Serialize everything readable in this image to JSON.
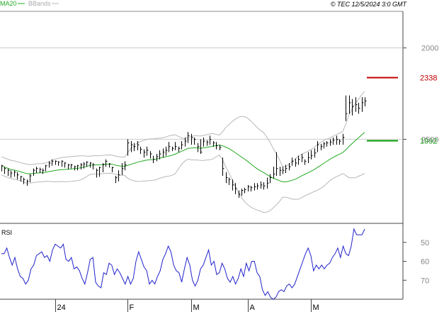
{
  "header": {
    "legend_ma": "MA20",
    "legend_bb": "BBands",
    "copyright": "© TEC 12/5/2024 3:0 GMT"
  },
  "price_axis": {
    "ticks": [
      "2500",
      "2000"
    ]
  },
  "rsi_axis": {
    "label": "RSI",
    "ticks": [
      "70",
      "60",
      "50"
    ]
  },
  "x_axis": {
    "ticks": [
      "24",
      "F",
      "M",
      "A",
      "M"
    ]
  },
  "levels": [
    {
      "value": 2338,
      "label": "2338",
      "color": "#c00000"
    },
    {
      "value": 1992,
      "label": "1992",
      "color": "#009900"
    }
  ],
  "colors": {
    "bars": "#000000",
    "ma": "#22aa22",
    "bbands": "#b8b8b8",
    "rsi": "#2222cc",
    "grid": "#cccccc",
    "axis": "#444444",
    "text": "#000000"
  },
  "chart_data": [
    {
      "type": "ohlc",
      "panel": "price",
      "ylim": [
        1540,
        2700
      ],
      "ticks": [
        2000,
        2500
      ],
      "grid": true,
      "bars": [
        [
          1855,
          1825,
          1860
        ],
        [
          1840,
          1810,
          1850
        ],
        [
          1830,
          1800,
          1840
        ],
        [
          1815,
          1790,
          1830
        ],
        [
          1820,
          1795,
          1830
        ],
        [
          1805,
          1780,
          1820
        ],
        [
          1795,
          1770,
          1800
        ],
        [
          1780,
          1755,
          1790
        ],
        [
          1770,
          1745,
          1780
        ],
        [
          1800,
          1765,
          1810
        ],
        [
          1830,
          1800,
          1840
        ],
        [
          1840,
          1815,
          1850
        ],
        [
          1835,
          1815,
          1845
        ],
        [
          1830,
          1810,
          1840
        ],
        [
          1855,
          1825,
          1860
        ],
        [
          1870,
          1845,
          1880
        ],
        [
          1880,
          1855,
          1890
        ],
        [
          1880,
          1860,
          1885
        ],
        [
          1875,
          1855,
          1880
        ],
        [
          1880,
          1850,
          1885
        ],
        [
          1870,
          1845,
          1875
        ],
        [
          1860,
          1835,
          1865
        ],
        [
          1860,
          1840,
          1865
        ],
        [
          1850,
          1830,
          1855
        ],
        [
          1855,
          1830,
          1860
        ],
        [
          1860,
          1835,
          1870
        ],
        [
          1865,
          1840,
          1875
        ],
        [
          1875,
          1850,
          1880
        ],
        [
          1870,
          1845,
          1875
        ],
        [
          1860,
          1835,
          1870
        ],
        [
          1830,
          1790,
          1840
        ],
        [
          1845,
          1795,
          1850
        ],
        [
          1860,
          1820,
          1870
        ],
        [
          1880,
          1850,
          1890
        ],
        [
          1865,
          1845,
          1870
        ],
        [
          1845,
          1820,
          1850
        ],
        [
          1790,
          1760,
          1800
        ],
        [
          1805,
          1770,
          1830
        ],
        [
          1840,
          1805,
          1870
        ],
        [
          1860,
          1830,
          1880
        ],
        [
          1980,
          1910,
          2000
        ],
        [
          1970,
          1930,
          1990
        ],
        [
          1960,
          1935,
          1980
        ],
        [
          1970,
          1940,
          1990
        ],
        [
          1945,
          1920,
          1960
        ],
        [
          1930,
          1900,
          1945
        ],
        [
          1940,
          1910,
          1960
        ],
        [
          1920,
          1895,
          1935
        ],
        [
          1890,
          1870,
          1910
        ],
        [
          1905,
          1880,
          1920
        ],
        [
          1920,
          1890,
          1940
        ],
        [
          1930,
          1900,
          1950
        ],
        [
          1940,
          1910,
          1960
        ],
        [
          1960,
          1930,
          1985
        ],
        [
          1950,
          1935,
          1960
        ],
        [
          1960,
          1940,
          1985
        ],
        [
          1950,
          1930,
          1960
        ],
        [
          1970,
          1945,
          1990
        ],
        [
          1990,
          1960,
          2010
        ],
        [
          2020,
          1980,
          2040
        ],
        [
          2010,
          1970,
          2030
        ],
        [
          2000,
          1970,
          2010
        ],
        [
          1960,
          1930,
          1980
        ],
        [
          1930,
          1920,
          2000
        ],
        [
          1990,
          1960,
          2010
        ],
        [
          1985,
          1965,
          1995
        ],
        [
          2000,
          1970,
          2020
        ],
        [
          1980,
          1960,
          1990
        ],
        [
          1965,
          1945,
          1985
        ],
        [
          1955,
          1940,
          1970
        ],
        [
          1840,
          1800,
          1900
        ],
        [
          1790,
          1760,
          1820
        ],
        [
          1780,
          1750,
          1790
        ],
        [
          1750,
          1720,
          1780
        ],
        [
          1730,
          1700,
          1760
        ],
        [
          1700,
          1680,
          1720
        ],
        [
          1720,
          1690,
          1730
        ],
        [
          1725,
          1705,
          1735
        ],
        [
          1740,
          1715,
          1750
        ],
        [
          1735,
          1715,
          1745
        ],
        [
          1740,
          1720,
          1760
        ],
        [
          1745,
          1725,
          1760
        ],
        [
          1750,
          1730,
          1770
        ],
        [
          1745,
          1725,
          1765
        ],
        [
          1760,
          1730,
          1790
        ],
        [
          1790,
          1760,
          1810
        ],
        [
          1810,
          1785,
          1850
        ],
        [
          1840,
          1800,
          1930
        ],
        [
          1830,
          1800,
          1850
        ],
        [
          1830,
          1810,
          1850
        ],
        [
          1840,
          1815,
          1860
        ],
        [
          1850,
          1830,
          1870
        ],
        [
          1880,
          1855,
          1900
        ],
        [
          1870,
          1850,
          1895
        ],
        [
          1890,
          1860,
          1910
        ],
        [
          1900,
          1875,
          1920
        ],
        [
          1880,
          1860,
          1890
        ],
        [
          1900,
          1870,
          1930
        ],
        [
          1910,
          1890,
          1940
        ],
        [
          1925,
          1900,
          1950
        ],
        [
          1970,
          1930,
          1990
        ],
        [
          1960,
          1940,
          1975
        ],
        [
          1975,
          1950,
          1985
        ],
        [
          1980,
          1960,
          1990
        ],
        [
          1985,
          1965,
          2000
        ],
        [
          1995,
          1970,
          2010
        ],
        [
          2000,
          1970,
          2020
        ],
        [
          1990,
          1970,
          2000
        ],
        [
          2010,
          1970,
          2030
        ],
        [
          2140,
          2100,
          2240
        ],
        [
          2200,
          2140,
          2240
        ],
        [
          2180,
          2130,
          2220
        ],
        [
          2190,
          2150,
          2230
        ],
        [
          2170,
          2140,
          2200
        ],
        [
          2200,
          2150,
          2230
        ],
        [
          2210,
          2180,
          2230
        ]
      ]
    },
    {
      "type": "line",
      "panel": "rsi",
      "ylim": [
        40,
        80
      ],
      "ticks": [
        50,
        60,
        70
      ],
      "series": [
        {
          "name": "RSI",
          "values": [
            64,
            64,
            67,
            62,
            58,
            62,
            56,
            52,
            51,
            48,
            50,
            56,
            58,
            63,
            64,
            65,
            62,
            63,
            60,
            66,
            69,
            68,
            67,
            69,
            61,
            60,
            62,
            56,
            57,
            55,
            51,
            48,
            54,
            61,
            62,
            49,
            47,
            46,
            54,
            53,
            59,
            58,
            53,
            56,
            54,
            51,
            48,
            52,
            48,
            51,
            60,
            65,
            61,
            57,
            55,
            48,
            50,
            48,
            52,
            55,
            61,
            64,
            68,
            65,
            58,
            55,
            54,
            49,
            56,
            62,
            58,
            50,
            47,
            50,
            56,
            58,
            62,
            66,
            58,
            60,
            53,
            54,
            59,
            56,
            51,
            49,
            52,
            48,
            51,
            56,
            52,
            59,
            55,
            60,
            60,
            54,
            52,
            45,
            42,
            44,
            41,
            40,
            41,
            44,
            45,
            44,
            47,
            48,
            46,
            48,
            52,
            56,
            60,
            64,
            67,
            63,
            55,
            58,
            56,
            58,
            56,
            58,
            59,
            62,
            64,
            67,
            62,
            68,
            64,
            63,
            68,
            77,
            74,
            74,
            74,
            77
          ]
        }
      ]
    }
  ]
}
